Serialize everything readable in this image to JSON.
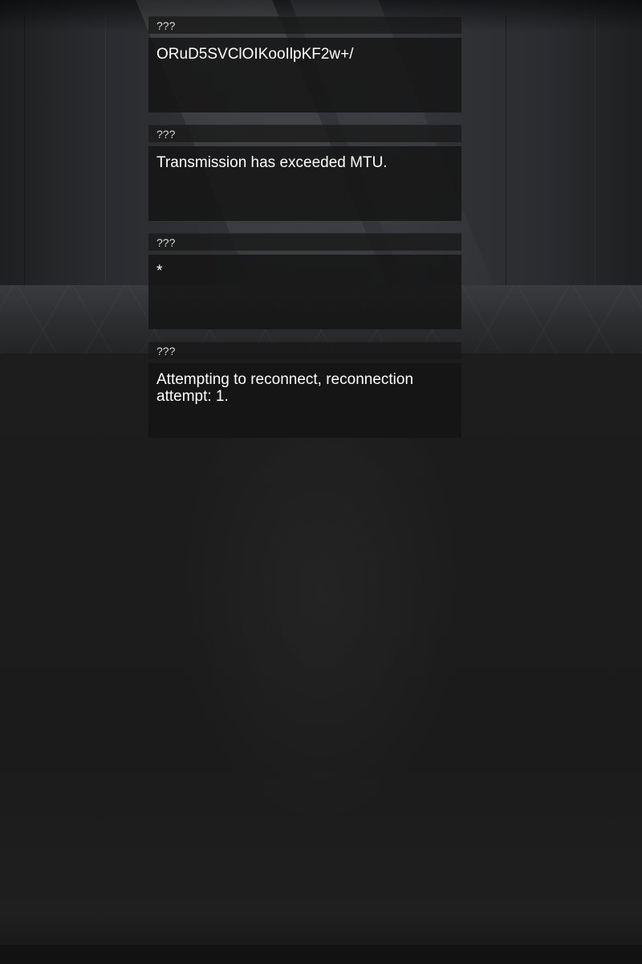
{
  "messages": [
    {
      "sender": "???",
      "text": "ORuD5SVClOIKooIlpKF2w+/"
    },
    {
      "sender": "???",
      "text": "Transmission has exceeded MTU."
    },
    {
      "sender": "???",
      "text": "*"
    },
    {
      "sender": "???",
      "text": "Attempting to reconnect, reconnection attempt: 1."
    }
  ]
}
